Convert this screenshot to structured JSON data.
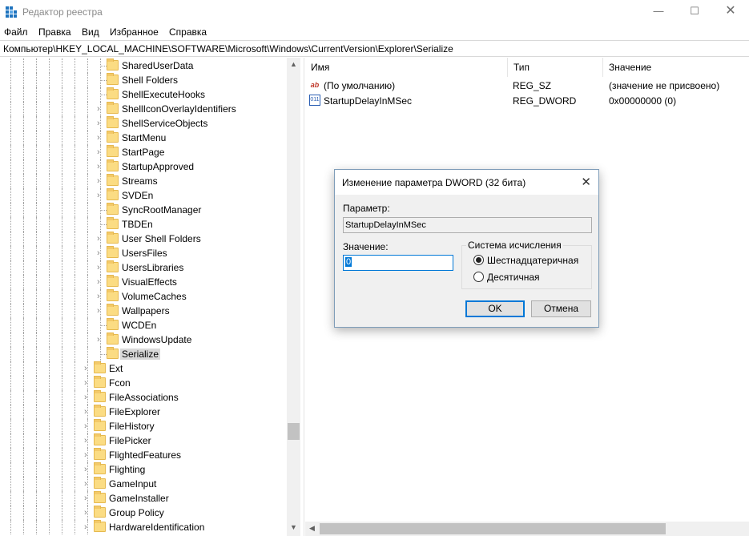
{
  "window": {
    "title": "Редактор реестра",
    "controls": {
      "minimize": "—",
      "maximize": "☐",
      "close": "✕"
    }
  },
  "menu": {
    "items": [
      "Файл",
      "Правка",
      "Вид",
      "Избранное",
      "Справка"
    ]
  },
  "address": {
    "path": "Компьютер\\HKEY_LOCAL_MACHINE\\SOFTWARE\\Microsoft\\Windows\\CurrentVersion\\Explorer\\Serialize"
  },
  "tree": {
    "items": [
      {
        "label": "SharedUserData",
        "expandable": false
      },
      {
        "label": "Shell Folders",
        "expandable": false
      },
      {
        "label": "ShellExecuteHooks",
        "expandable": false
      },
      {
        "label": "ShellIconOverlayIdentifiers",
        "expandable": true
      },
      {
        "label": "ShellServiceObjects",
        "expandable": true
      },
      {
        "label": "StartMenu",
        "expandable": true
      },
      {
        "label": "StartPage",
        "expandable": true
      },
      {
        "label": "StartupApproved",
        "expandable": true
      },
      {
        "label": "Streams",
        "expandable": true
      },
      {
        "label": "SVDEn",
        "expandable": true
      },
      {
        "label": "SyncRootManager",
        "expandable": false
      },
      {
        "label": "TBDEn",
        "expandable": false
      },
      {
        "label": "User Shell Folders",
        "expandable": true
      },
      {
        "label": "UsersFiles",
        "expandable": true
      },
      {
        "label": "UsersLibraries",
        "expandable": true
      },
      {
        "label": "VisualEffects",
        "expandable": true
      },
      {
        "label": "VolumeCaches",
        "expandable": true
      },
      {
        "label": "Wallpapers",
        "expandable": true
      },
      {
        "label": "WCDEn",
        "expandable": false
      },
      {
        "label": "WindowsUpdate",
        "expandable": true
      },
      {
        "label": "Serialize",
        "expandable": false,
        "selected": true
      },
      {
        "label": "Ext",
        "expandable": true,
        "level": 1
      },
      {
        "label": "Fcon",
        "expandable": true,
        "level": 1
      },
      {
        "label": "FileAssociations",
        "expandable": true,
        "level": 1
      },
      {
        "label": "FileExplorer",
        "expandable": true,
        "level": 1
      },
      {
        "label": "FileHistory",
        "expandable": true,
        "level": 1
      },
      {
        "label": "FilePicker",
        "expandable": true,
        "level": 1
      },
      {
        "label": "FlightedFeatures",
        "expandable": true,
        "level": 1
      },
      {
        "label": "Flighting",
        "expandable": true,
        "level": 1
      },
      {
        "label": "GameInput",
        "expandable": true,
        "level": 1
      },
      {
        "label": "GameInstaller",
        "expandable": true,
        "level": 1
      },
      {
        "label": "Group Policy",
        "expandable": true,
        "level": 1
      },
      {
        "label": "HardwareIdentification",
        "expandable": true,
        "level": 1
      }
    ]
  },
  "values_pane": {
    "columns": {
      "name": "Имя",
      "type": "Тип",
      "data": "Значение"
    },
    "rows": [
      {
        "icon": "string-value-icon",
        "name": "(По умолчанию)",
        "type": "REG_SZ",
        "data": "(значение не присвоено)"
      },
      {
        "icon": "binary-value-icon",
        "name": "StartupDelayInMSec",
        "type": "REG_DWORD",
        "data": "0x00000000 (0)"
      }
    ]
  },
  "dialog": {
    "title": "Изменение параметра DWORD (32 бита)",
    "param_label": "Параметр:",
    "param_value": "StartupDelayInMSec",
    "value_label": "Значение:",
    "value": "0",
    "base_group_title": "Система исчисления",
    "base_options": [
      {
        "label": "Шестнадцатеричная",
        "checked": true
      },
      {
        "label": "Десятичная",
        "checked": false
      }
    ],
    "ok_label": "OK",
    "cancel_label": "Отмена",
    "close_glyph": "✕"
  },
  "colors": {
    "selection": "#0078d7",
    "folder": "#fbdc83"
  }
}
